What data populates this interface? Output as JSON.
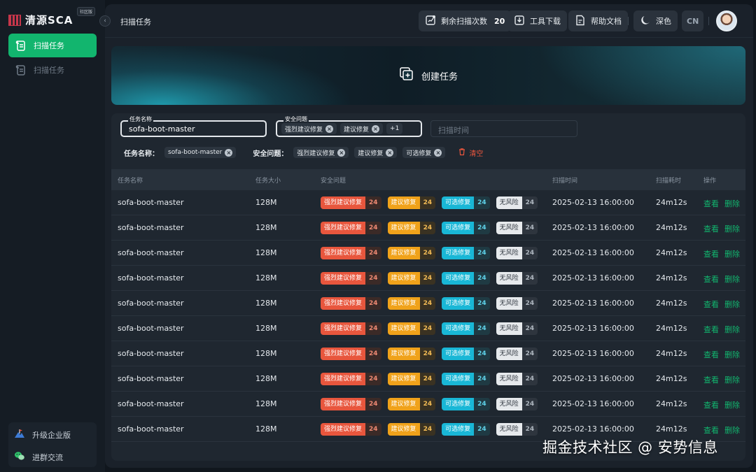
{
  "app": {
    "name": "清源SCA",
    "edition": "社区版"
  },
  "sidebar": {
    "items": [
      {
        "label": "扫描任务",
        "active": true,
        "icon": "scroll-icon"
      },
      {
        "label": "扫描任务",
        "active": false,
        "icon": "scroll-icon"
      }
    ],
    "bottom": [
      {
        "label": "升级企业版",
        "icon": "mountain-flag-icon"
      },
      {
        "label": "进群交流",
        "icon": "wechat-icon"
      }
    ]
  },
  "topbar": {
    "title": "扫描任务",
    "remaining_label": "剩余扫描次数",
    "remaining_count": "20",
    "tool_download": "工具下载",
    "help_docs": "帮助文档",
    "theme_label": "深色",
    "lang_label": "CN"
  },
  "hero": {
    "create_label": "创建任务"
  },
  "filters": {
    "task_name_label": "任务名称",
    "task_name_value": "sofa-boot-master",
    "security_label": "安全问题",
    "security_chips": [
      "强烈建议修复",
      "建议修复"
    ],
    "security_more": "+1",
    "scan_time_placeholder": "扫描时间",
    "applied": {
      "task_name_label": "任务名称：",
      "task_name_value": "sofa-boot-master",
      "security_label": "安全问题：",
      "security_values": [
        "强烈建议修复",
        "建议修复",
        "可选修复"
      ],
      "clear_label": "清空"
    }
  },
  "table": {
    "headers": [
      "任务名称",
      "任务大小",
      "安全问题",
      "扫描时间",
      "扫描耗时",
      "操作"
    ],
    "tag_labels": [
      "强烈建议修复",
      "建议修复",
      "可选修复",
      "无风险"
    ],
    "view_label": "查看",
    "delete_label": "删除",
    "rows": [
      {
        "name": "sofa-boot-master",
        "size": "128M",
        "counts": [
          "24",
          "24",
          "24",
          "24"
        ],
        "time": "2025-02-13 16:00:00",
        "duration": "24m12s"
      },
      {
        "name": "sofa-boot-master",
        "size": "128M",
        "counts": [
          "24",
          "24",
          "24",
          "24"
        ],
        "time": "2025-02-13 16:00:00",
        "duration": "24m12s"
      },
      {
        "name": "sofa-boot-master",
        "size": "128M",
        "counts": [
          "24",
          "24",
          "24",
          "24"
        ],
        "time": "2025-02-13 16:00:00",
        "duration": "24m12s"
      },
      {
        "name": "sofa-boot-master",
        "size": "128M",
        "counts": [
          "24",
          "24",
          "24",
          "24"
        ],
        "time": "2025-02-13 16:00:00",
        "duration": "24m12s"
      },
      {
        "name": "sofa-boot-master",
        "size": "128M",
        "counts": [
          "24",
          "24",
          "24",
          "24"
        ],
        "time": "2025-02-13 16:00:00",
        "duration": "24m12s"
      },
      {
        "name": "sofa-boot-master",
        "size": "128M",
        "counts": [
          "24",
          "24",
          "24",
          "24"
        ],
        "time": "2025-02-13 16:00:00",
        "duration": "24m12s"
      },
      {
        "name": "sofa-boot-master",
        "size": "128M",
        "counts": [
          "24",
          "24",
          "24",
          "24"
        ],
        "time": "2025-02-13 16:00:00",
        "duration": "24m12s"
      },
      {
        "name": "sofa-boot-master",
        "size": "128M",
        "counts": [
          "24",
          "24",
          "24",
          "24"
        ],
        "time": "2025-02-13 16:00:00",
        "duration": "24m12s"
      },
      {
        "name": "sofa-boot-master",
        "size": "128M",
        "counts": [
          "24",
          "24",
          "24",
          "24"
        ],
        "time": "2025-02-13 16:00:00",
        "duration": "24m12s"
      },
      {
        "name": "sofa-boot-master",
        "size": "128M",
        "counts": [
          "24",
          "24",
          "24",
          "24"
        ],
        "time": "2025-02-13 16:00:00",
        "duration": "24m12s"
      }
    ]
  },
  "colors": {
    "accent": "#12b56e",
    "danger": "#e8563d",
    "warning": "#f0a21a",
    "info": "#19b7d6"
  },
  "watermark": "掘金技术社区 @ 安势信息"
}
